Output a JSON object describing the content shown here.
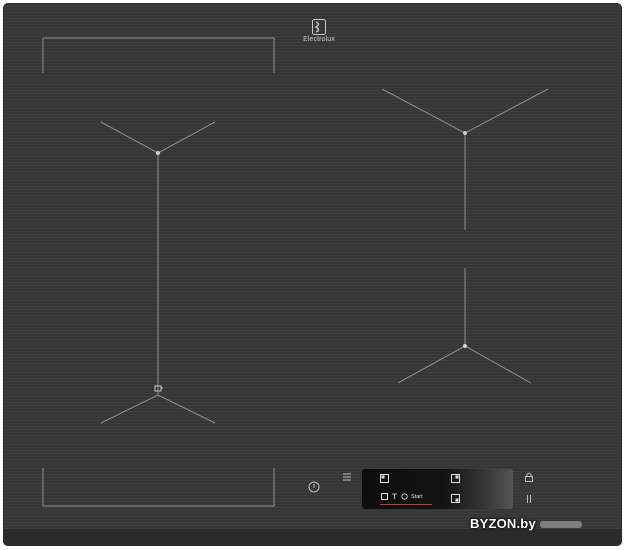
{
  "brand": {
    "name": "Electrolux"
  },
  "controls": {
    "start_label": "Start",
    "icons": [
      "power-icon",
      "menu-icon",
      "zone-bridge-icon",
      "timer-icon",
      "lock-icon",
      "pause-icon"
    ]
  },
  "watermark": {
    "text": "BYZON.by"
  },
  "colors": {
    "surface": "#363637",
    "lines": "#9a9a9a",
    "display": "#141414",
    "accent": "#c23a3a"
  }
}
